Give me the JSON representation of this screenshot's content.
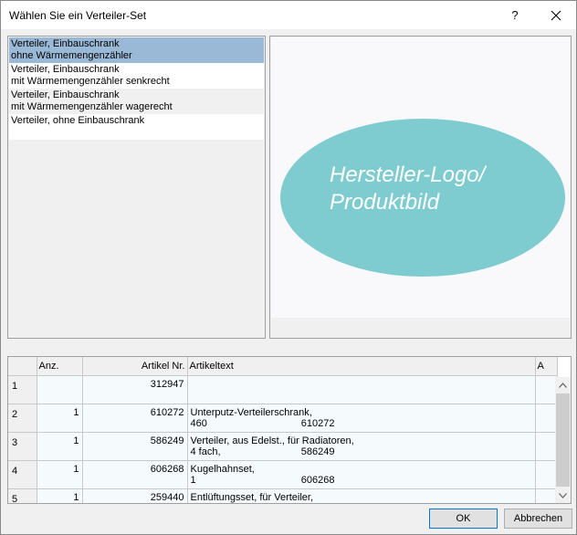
{
  "window": {
    "title": "Wählen Sie ein Verteiler-Set",
    "help_label": "?"
  },
  "set_list": {
    "items": [
      {
        "line1": "Verteiler, Einbauschrank",
        "line2": "ohne Wärmemengenzähler",
        "selected": true
      },
      {
        "line1": "Verteiler, Einbauschrank",
        "line2": "mit Wärmemengenzähler senkrecht",
        "selected": false
      },
      {
        "line1": "Verteiler, Einbauschrank",
        "line2": "mit Wärmemengenzähler wagerecht",
        "selected": false
      },
      {
        "line1": "Verteiler, ohne Einbauschrank",
        "line2": "",
        "selected": false
      }
    ]
  },
  "preview": {
    "line1": "Hersteller-Logo/",
    "line2": "Produktbild",
    "ellipse_color": "#7ecbd0"
  },
  "table": {
    "columns": [
      "",
      "Anz.",
      "Artikel Nr.",
      "Artikeltext",
      "A"
    ],
    "rows": [
      {
        "num": "1",
        "anz": "",
        "artikel_nr": "312947",
        "text1": "",
        "text2a": "",
        "text2b": ""
      },
      {
        "num": "2",
        "anz": "1",
        "artikel_nr": "610272",
        "text1": "Unterputz-Verteilerschrank,",
        "text2a": "460",
        "text2b": "610272"
      },
      {
        "num": "3",
        "anz": "1",
        "artikel_nr": "586249",
        "text1": "Verteiler, aus Edelst., für Radiatoren,",
        "text2a": "4 fach,",
        "text2b": "586249"
      },
      {
        "num": "4",
        "anz": "1",
        "artikel_nr": "606268",
        "text1": "Kugelhahnset,",
        "text2a": "1",
        "text2b": "606268"
      },
      {
        "num": "5",
        "anz": "1",
        "artikel_nr": "259440",
        "text1": "Entlüftungsset, für Verteiler,",
        "text2a": "",
        "text2b": ""
      }
    ]
  },
  "buttons": {
    "ok": "OK",
    "cancel": "Abbrechen"
  },
  "colors": {
    "selection": "#99b9d7",
    "accent_border": "#0078d7"
  }
}
